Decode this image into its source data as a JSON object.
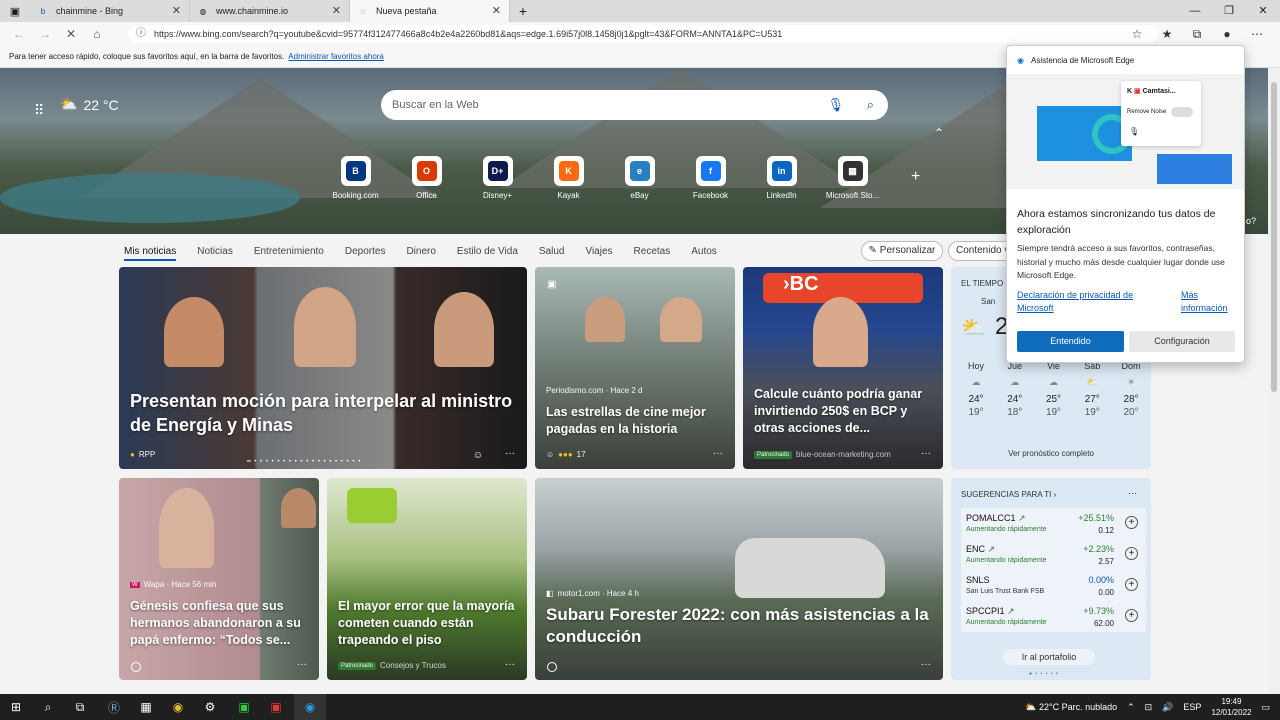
{
  "tabs": [
    {
      "label": "chainmine - Bing"
    },
    {
      "label": "www.chainmine.io"
    },
    {
      "label": "Nueva pestaña"
    }
  ],
  "address": {
    "url": "https://www.bing.com/search?q=youtube&cvid=95774f312477466a8c4b2e4a2260bd81&aqs=edge.1.69i57j0l8.1458j0j1&pglt=43&FORM=ANNTA1&PC=U531"
  },
  "favbar": {
    "text": "Para tener acceso rápido, coloque sus favoritos aquí, en la barra de favoritos.",
    "link": "Administrar favoritos ahora"
  },
  "hero": {
    "temp": "22 °C",
    "search_placeholder": "Buscar en la Web"
  },
  "quick_links": [
    {
      "label": "Booking.com",
      "letter": "B",
      "color": "#003580"
    },
    {
      "label": "Office",
      "letter": "O",
      "color": "#d83b01"
    },
    {
      "label": "Disney+",
      "letter": "D+",
      "color": "#0d1b4d"
    },
    {
      "label": "Kayak",
      "letter": "K",
      "color": "#ff690f"
    },
    {
      "label": "eBay",
      "letter": "e",
      "color": "#2a7fc0"
    },
    {
      "label": "Facebook",
      "letter": "f",
      "color": "#1877f2"
    },
    {
      "label": "LinkedIn",
      "letter": "in",
      "color": "#0a66c2"
    },
    {
      "label": "Microsoft Sto...",
      "letter": "▦",
      "color": "#333333"
    }
  ],
  "feed_nav": [
    "Mis noticias",
    "Noticias",
    "Entretenimiento",
    "Deportes",
    "Dinero",
    "Estilo de Vida",
    "Salud",
    "Viajes",
    "Recetas",
    "Autos"
  ],
  "personalize": "Personalizar",
  "contenido": "Contenido v",
  "cards": {
    "c1": {
      "title": "Presentan moción para interpelar al ministro de Energía y Minas",
      "source": "RPP"
    },
    "c2": {
      "source": "Periodismo.com · Hace 2 d",
      "title": "Las estrellas de cine mejor pagadas en la historia",
      "reactions": "17"
    },
    "c3": {
      "title": "Calcule cuánto podría ganar invirtiendo 250$ en BCP y otras acciones de...",
      "sponsored": "Patrocinado",
      "source": "blue-ocean-marketing.com"
    },
    "c4": {
      "source": "Wapa · Hace 56 min",
      "title": "Génesis confiesa que sus hermanos abandonaron a su papá enfermo: “Todos se..."
    },
    "c5": {
      "title": "El mayor error que la mayoría cometen cuando están trapeando el piso",
      "sponsored": "Patrocinado",
      "source": "Consejos y Trucos"
    },
    "c6": {
      "source": "motor1.com · Hace 4 h",
      "title": "Subaru Forester 2022: con más asistencias a la conducción"
    }
  },
  "weather": {
    "title": "EL TIEMPO",
    "loc": "San",
    "big": "2",
    "days": [
      {
        "d": "Hoy",
        "hi": "24°",
        "lo": "19°"
      },
      {
        "d": "Jue",
        "hi": "24°",
        "lo": "18°"
      },
      {
        "d": "Vie",
        "hi": "25°",
        "lo": "19°"
      },
      {
        "d": "Sáb",
        "hi": "27°",
        "lo": "19°"
      },
      {
        "d": "Dom",
        "hi": "28°",
        "lo": "20°"
      }
    ],
    "link": "Ver pronóstico completo"
  },
  "stocks": {
    "title": "SUGERENCIAS PARA TI",
    "items": [
      {
        "sym": "POMALCC1",
        "sub": "Aumentando rápidamente",
        "chg": "+25.51%",
        "val": "0.12"
      },
      {
        "sym": "ENC",
        "sub": "Aumentando rápidamente",
        "chg": "+2.23%",
        "val": "2.57"
      },
      {
        "sym": "SNLS",
        "sub": "San Luis Trust Bank FSB",
        "chg": "0.00%",
        "val": "0.00"
      },
      {
        "sym": "SPCCPI1",
        "sub": "Aumentando rápidamente",
        "chg": "+9.73%",
        "val": "62.00"
      }
    ],
    "button": "Ir al portafolio"
  },
  "popup": {
    "header": "Asistencia de Microsoft Edge",
    "app": "Camtasi...",
    "noise": "Remove Noise",
    "heading": "Ahora estamos sincronizando tus datos de exploración",
    "body": "Siempre tendrá acceso a sus favoritos, contraseñas, historial y mucho más desde cualquier lugar donde use Microsoft Edge.",
    "link1": "Declaración de privacidad de Microsoft",
    "link2": "Más información",
    "btn_ok": "Entendido",
    "btn_cfg": "Configuración"
  },
  "taskbar": {
    "weather": "22°C  Parc. nublado",
    "lang": "ESP",
    "time": "19:49",
    "date": "12/01/2022"
  },
  "side_hint": "o?"
}
